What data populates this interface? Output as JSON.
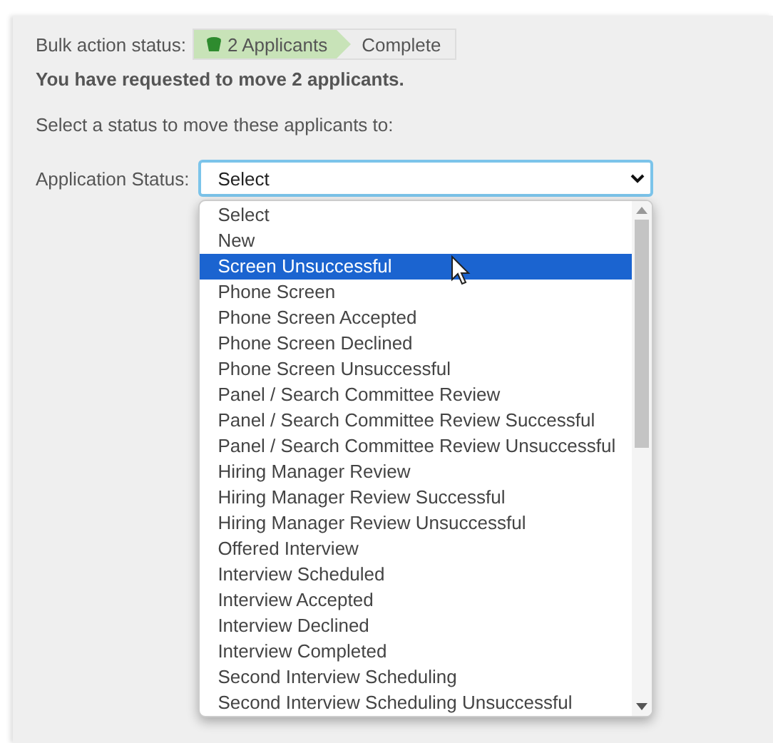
{
  "bulk_status": {
    "label": "Bulk action status:",
    "steps": [
      {
        "label": "2 Applicants",
        "selected": true
      },
      {
        "label": "Complete",
        "selected": false
      }
    ]
  },
  "message": "You have requested to move 2 applicants.",
  "instruction": "Select a status to move these applicants to:",
  "status_field": {
    "label": "Application Status:",
    "value": "Select",
    "expanded": true
  },
  "options": [
    {
      "label": "Select",
      "selected": false
    },
    {
      "label": "New",
      "selected": false
    },
    {
      "label": "Screen Unsuccessful",
      "selected": true
    },
    {
      "label": "Phone Screen",
      "selected": false
    },
    {
      "label": "Phone Screen Accepted",
      "selected": false
    },
    {
      "label": "Phone Screen Declined",
      "selected": false
    },
    {
      "label": "Phone Screen Unsuccessful",
      "selected": false
    },
    {
      "label": "Panel / Search Committee Review",
      "selected": false
    },
    {
      "label": "Panel / Search Committee Review Successful",
      "selected": false
    },
    {
      "label": "Panel / Search Committee Review Unsuccessful",
      "selected": false
    },
    {
      "label": "Hiring Manager Review",
      "selected": false
    },
    {
      "label": "Hiring Manager Review Successful",
      "selected": false
    },
    {
      "label": "Hiring Manager Review Unsuccessful",
      "selected": false
    },
    {
      "label": "Offered Interview",
      "selected": false
    },
    {
      "label": "Interview Scheduled",
      "selected": false
    },
    {
      "label": "Interview Accepted",
      "selected": false
    },
    {
      "label": "Interview Declined",
      "selected": false
    },
    {
      "label": "Interview Completed",
      "selected": false
    },
    {
      "label": "Second Interview Scheduling",
      "selected": false
    },
    {
      "label": "Second Interview Scheduling Unsuccessful",
      "selected": false
    }
  ]
}
